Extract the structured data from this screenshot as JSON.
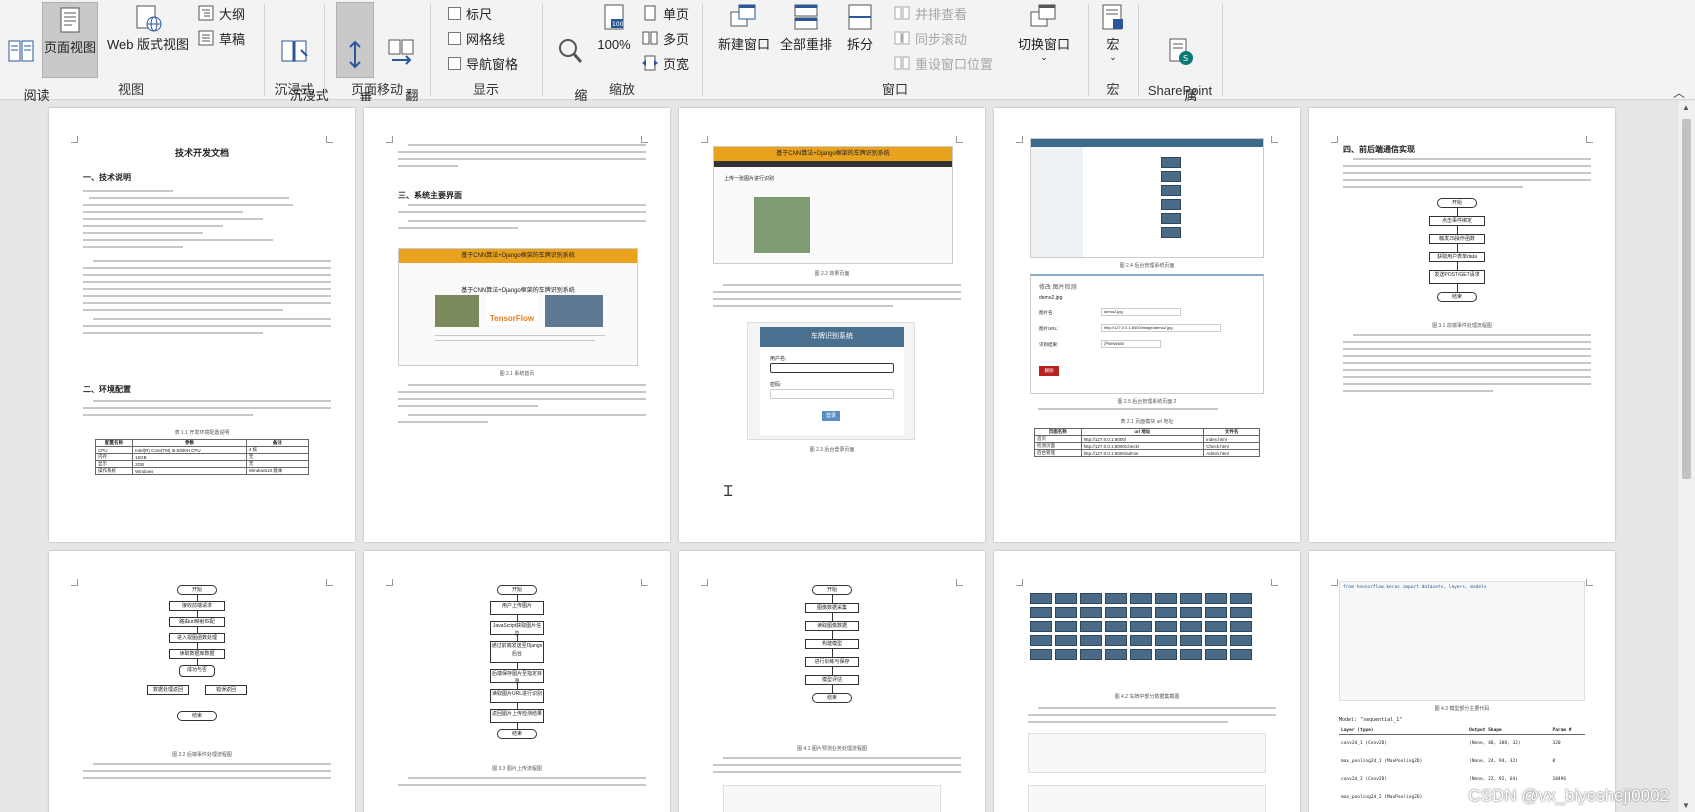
{
  "ribbon": {
    "view_group": {
      "reading_view": "阅读\n视图",
      "page_view": "页面视图",
      "web_layout": "Web 版式视图",
      "outline": "大纲",
      "draft": "草稿",
      "label": "视图"
    },
    "immersive_group": {
      "immersive_reader": "沉浸式\n阅读器",
      "label": "沉浸式"
    },
    "page_move_group": {
      "vertical": "垂\n直",
      "side_to_side": "翻\n页",
      "label": "页面移动"
    },
    "show_group": {
      "ruler": "标尺",
      "gridlines": "网格线",
      "nav_pane": "导航窗格",
      "label": "显示"
    },
    "zoom_group": {
      "zoom": "缩\n放",
      "hundred": "100%",
      "one_page": "单页",
      "multi_page": "多页",
      "page_width": "页宽",
      "label": "缩放"
    },
    "window_group": {
      "new_window": "新建窗口",
      "arrange_all": "全部重排",
      "split": "拆分",
      "side_by_side": "并排查看",
      "sync_scroll": "同步滚动",
      "reset_pos": "重设窗口位置",
      "switch_windows": "切换窗口",
      "label": "窗口"
    },
    "macro_group": {
      "macros": "宏",
      "label": "宏"
    },
    "sharepoint_group": {
      "properties": "属\n性",
      "label": "SharePoint"
    },
    "accent": "#2b579a"
  },
  "pages": {
    "p1": {
      "title": "技术开发文档",
      "h1": "一、技术说明",
      "h2": "二、环境配置",
      "table_caption": "表 1.1 开发环境配置说明",
      "table_header": [
        "配置名称",
        "参数",
        "备注"
      ],
      "table_rows": [
        [
          "CPU",
          "Intel(R) Core(TM) i5-6300H CPU",
          "4 核"
        ],
        [
          "内存",
          "16GB",
          "无"
        ],
        [
          "显示",
          "2GB",
          "无"
        ],
        [
          "操作系统",
          "Windows",
          "Windows10 版本"
        ]
      ]
    },
    "p2": {
      "h": "三、系统主要界面",
      "banner": "基于CNN算法+Django框架的车牌识别系统",
      "subtitle": "基于CNN算法+Django框架的车牌识别系统",
      "logo": "TensorFlow",
      "cap": "图 2.1 系统首页"
    },
    "p3": {
      "banner": "基于CNN算法+Django框架的车牌识别系统",
      "upload_title": "上传一张图片进行识别",
      "cap1": "图 2.2 效果页面",
      "login_title": "车牌识别系统",
      "login_user": "用户名:",
      "login_pass": "密码:",
      "login_btn": "登录",
      "cap2": "图 2.3 后台登录页面"
    },
    "p4": {
      "cap1": "图 2.4 后台管理系统页面",
      "edit_title": "修改 图片检测",
      "filename": "demo2.jpg",
      "field1": "图片名:",
      "field1_val": "demo2.jpg",
      "field2": "图片URL:",
      "field2_val": "http://127.0.0.1:8000/image/demo2.jpg",
      "field3": "识别结果:",
      "field3_val": "沪BHW850",
      "btn": "删除",
      "cap2": "图 2.5 后台管理系统页面 2",
      "table_caption": "表 2.1 页面模块 url 地址",
      "table_header": [
        "页面名称",
        "url 地址",
        "文件名"
      ],
      "table_rows": [
        [
          "首页",
          "http://127.0.0.1:8000/",
          "index.html"
        ],
        [
          "检测页面",
          "http://127.0.0.1:8000/check/",
          "Check.html"
        ],
        [
          "后台管理",
          "http://127.0.0.1:8000/admin",
          "Admin.html"
        ]
      ]
    },
    "p5": {
      "h": "四、前后端通信实现",
      "flow": [
        "开始",
        "点击事件绑定",
        "触发JS操作函数",
        "获取用户表单data",
        "发送POST/GET请求",
        "结束"
      ],
      "cap": "图 3.1 前端事件处理流程图"
    },
    "p6": {
      "flow": [
        "开始",
        "接收前端请求",
        "路由url映射匹配",
        "进入视图函数处理",
        "读取数据库数据",
        "成功与否",
        "数据处理返回",
        "错误返回",
        "结束"
      ],
      "cap": "图 3.2 后端事件处理流程图"
    },
    "p7": {
      "flow": [
        "开始",
        "用户上传图片",
        "JavaScript获取图片信息",
        "通过前端发送至Django后台",
        "后端保存图片至指定目录",
        "读取图片URL进行识别",
        "返回图片上传检测结果",
        "结束"
      ],
      "cap": "图 3.3 图片上传流程图"
    },
    "p8": {
      "flow": [
        "开始",
        "图像数据采集",
        "读取图像数据",
        "构建模型",
        "进行训练与保存",
        "模型评估",
        "结束"
      ],
      "cap": "图 4.1 图片预测业务处理流程图"
    },
    "p9": {
      "cap": "图 4.2 车牌中部分数据集截图"
    },
    "p10": {
      "code_head": "from tensorflow.keras import datasets, layers, models",
      "table_title": "Model: \"sequential_1\"",
      "table_header": [
        "Layer (type)",
        "Output Shape",
        "Param #"
      ],
      "table_rows": [
        [
          "conv2d_1 (Conv2D)",
          "(None, 48, 188, 32)",
          "320"
        ],
        [
          "max_pooling2d_1 (MaxPooling2D)",
          "(None, 24, 94, 32)",
          "0"
        ],
        [
          "conv2d_2 (Conv2D)",
          "(None, 22, 92, 64)",
          "18496"
        ],
        [
          "max_pooling2d_2 (MaxPooling2D)",
          "",
          ""
        ]
      ],
      "cap": "图 4.3 模型部分主要代码"
    }
  },
  "watermark": "CSDN @vx_biyesheji0002"
}
